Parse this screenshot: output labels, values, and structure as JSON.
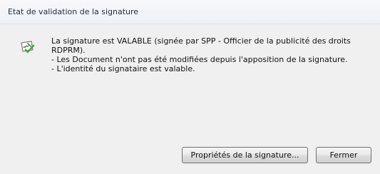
{
  "window": {
    "title": "Etat de validation de la signature"
  },
  "status": {
    "icon": "signature-valid-icon",
    "lines": [
      "La signature est VALABLE (signée par SPP - Officier de la publicité des droits",
      "RDPRM).",
      "- Les Document n'ont pas été modifiées depuis l'apposition de la signature.",
      "- L'identité du signataire est valable."
    ]
  },
  "buttons": {
    "properties_label": "Propriétés de la signature...",
    "close_label": "Fermer"
  },
  "colors": {
    "valid_check": "#3aa635",
    "dialog_background": "#f0f0f0"
  }
}
